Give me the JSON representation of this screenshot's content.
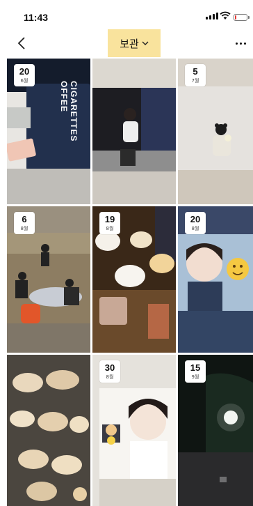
{
  "status_bar": {
    "time": "11:43"
  },
  "header": {
    "title": "보관"
  },
  "tiles": [
    {
      "day": "20",
      "month": "6월"
    },
    {
      "day": "",
      "month": ""
    },
    {
      "day": "5",
      "month": "7월"
    },
    {
      "day": "6",
      "month": "8월"
    },
    {
      "day": "19",
      "month": "8월"
    },
    {
      "day": "20",
      "month": "8월"
    },
    {
      "day": "",
      "month": ""
    },
    {
      "day": "30",
      "month": "8월"
    },
    {
      "day": "15",
      "month": "9월"
    }
  ],
  "photo_text": {
    "cup_line1": "OFFEE",
    "cup_line2": "CIGARETTES"
  },
  "colors": {
    "tab_highlight": "#f9e39d",
    "battery_low": "#e53935"
  }
}
